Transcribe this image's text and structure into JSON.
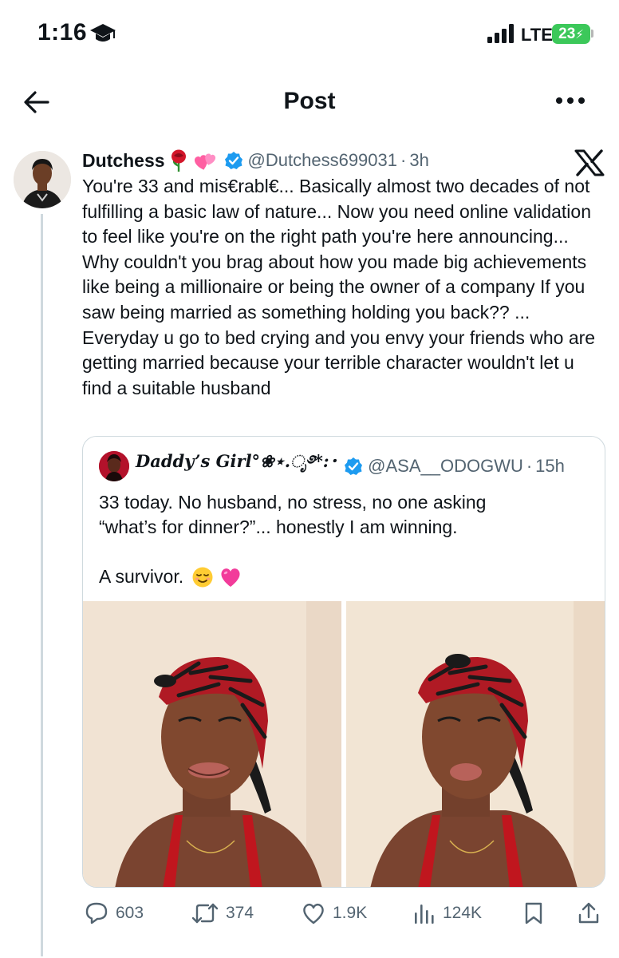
{
  "status_bar": {
    "time": "1:16",
    "network": "LTE",
    "battery": "23",
    "battery_color": "#3cc85a"
  },
  "header": {
    "title": "Post"
  },
  "post": {
    "author_name": "Dutchess",
    "author_handle": "@Dutchess699031",
    "separator": "·",
    "timeago": "3h",
    "emojis": [
      "rose-emoji",
      "heart-with-ribbon-emoji"
    ],
    "verified_color": "#1d9bf0",
    "text": "You're 33 and mis€rabl€... Basically almost two decades of not fulfilling a basic law of nature... Now you need online validation to feel like you're on the right path you're here announcing... Why couldn't you brag about how you made big achievements like being a millionaire or being the owner of a company If you saw being married as something holding you back?? ... Everyday u go to bed crying and you envy your friends who are getting married because your terrible character wouldn't let u find a suitable husband"
  },
  "quote": {
    "author_name": "Daddy’s Girl°❀⋆.ೃ࿔*:･",
    "author_handle": "@ASA__ODOGWU",
    "separator": "·",
    "timeago": "15h",
    "line1": "33 today. No husband, no stress, no one asking",
    "line2": "“what’s for dinner?”... honestly I am winning.",
    "line3": "A survivor.",
    "line3_emojis": [
      "relieved-face-emoji",
      "pink-heart-emoji"
    ],
    "images": [
      "selfie-photo-1",
      "selfie-photo-2"
    ]
  },
  "actions": {
    "replies": "603",
    "reposts": "374",
    "likes": "1.9K",
    "views": "124K"
  }
}
